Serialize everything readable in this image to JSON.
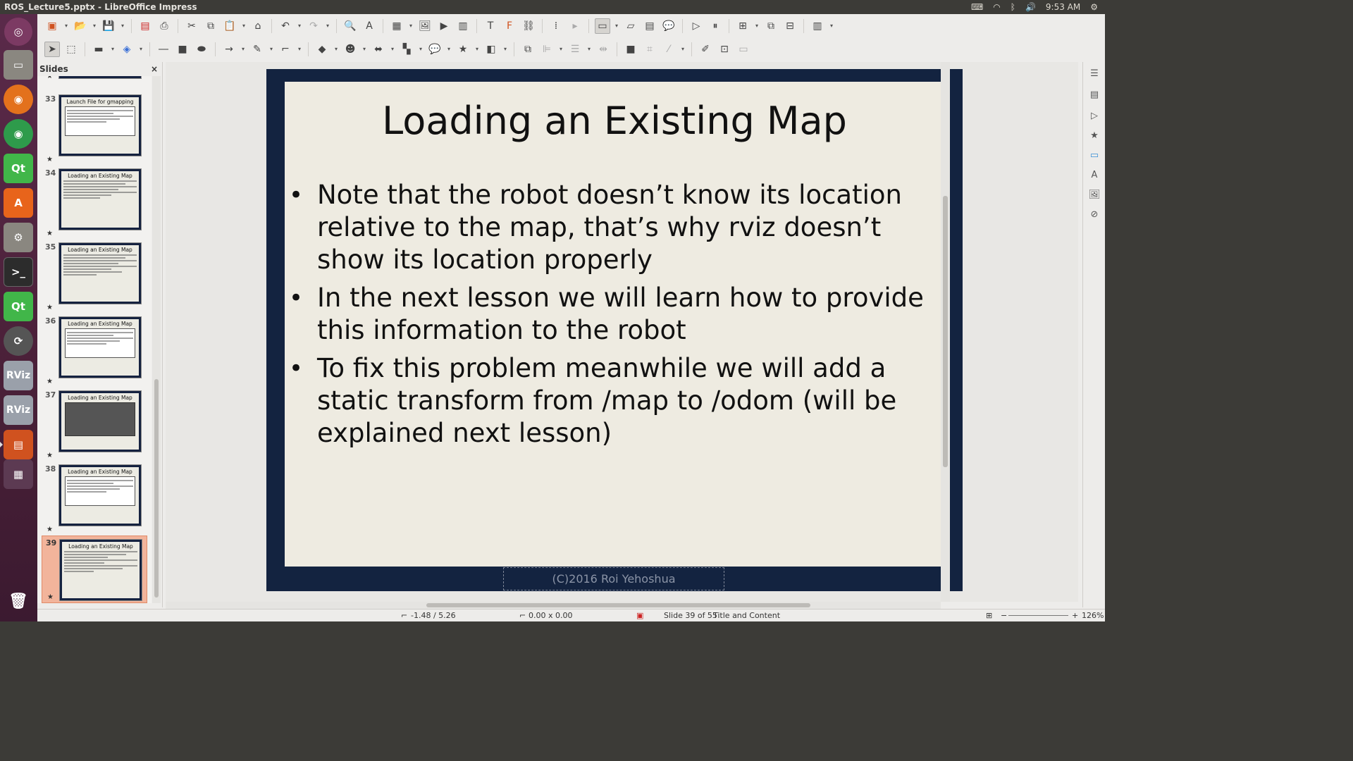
{
  "window": {
    "title": "ROS_Lecture5.pptx - LibreOffice Impress"
  },
  "indicators": {
    "time": "9:53 AM"
  },
  "slides_pane": {
    "title": "Slides",
    "close": "×",
    "thumbnails": [
      {
        "num": "33",
        "title": "Launch File for gmapping"
      },
      {
        "num": "34",
        "title": "Loading an Existing Map"
      },
      {
        "num": "35",
        "title": "Loading an Existing Map"
      },
      {
        "num": "36",
        "title": "Loading an Existing Map"
      },
      {
        "num": "37",
        "title": "Loading an Existing Map"
      },
      {
        "num": "38",
        "title": "Loading an Existing Map"
      },
      {
        "num": "39",
        "title": "Loading an Existing Map"
      }
    ]
  },
  "slide": {
    "title": "Loading an Existing Map",
    "bullets": [
      "Note that the robot doesn’t know its location relative to the map, that’s why rviz doesn’t show its location properly",
      "In the next lesson we will learn how to provide this information to the robot",
      "To fix this problem meanwhile we will add a static transform from /map to /odom (will be explained next lesson)"
    ],
    "footer": "(C)2016 Roi Yehoshua"
  },
  "status": {
    "position": "-1.48 / 5.26",
    "size": "0.00 x 0.00",
    "slide": "Slide 39 of 55",
    "layout": "Title and Content",
    "zoom": "126%"
  },
  "colors": {
    "slide_frame": "#132340",
    "slide_bg": "#eeebe1",
    "current_thumb": "#f2b49b",
    "launcher": "#5a2a4a"
  }
}
